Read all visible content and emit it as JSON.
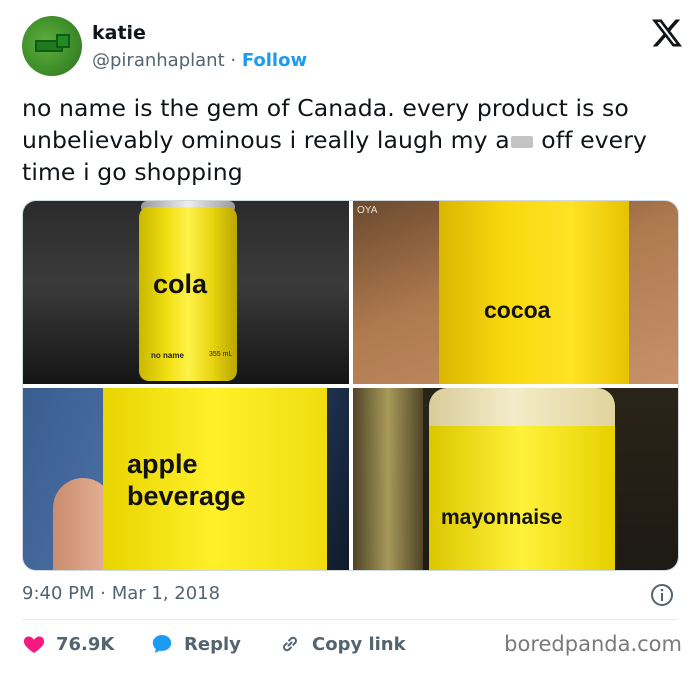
{
  "header": {
    "name": "katie",
    "handle": "@piranhaplant",
    "separator": " · ",
    "follow_label": "Follow"
  },
  "tweet": {
    "text_part1": "no name is the gem of Canada. every product is so unbelievably ominous i really laugh my a",
    "text_part2": " off every time i go shopping"
  },
  "media": {
    "tiles": [
      {
        "label": "cola",
        "brand": "no name",
        "volume": "355 mL"
      },
      {
        "label": "cocoa",
        "corner_text": "OYA"
      },
      {
        "label_line1": "apple",
        "label_line2": "beverage"
      },
      {
        "label": "mayonnaise"
      }
    ]
  },
  "meta": {
    "timestamp": "9:40 PM · Mar 1, 2018"
  },
  "actions": {
    "likes": "76.9K",
    "reply_label": "Reply",
    "copy_label": "Copy link"
  },
  "watermark": "boredpanda.com",
  "colors": {
    "accent": "#1d9bf0",
    "like": "#f91880",
    "text": "#0f1419",
    "muted": "#536471"
  }
}
